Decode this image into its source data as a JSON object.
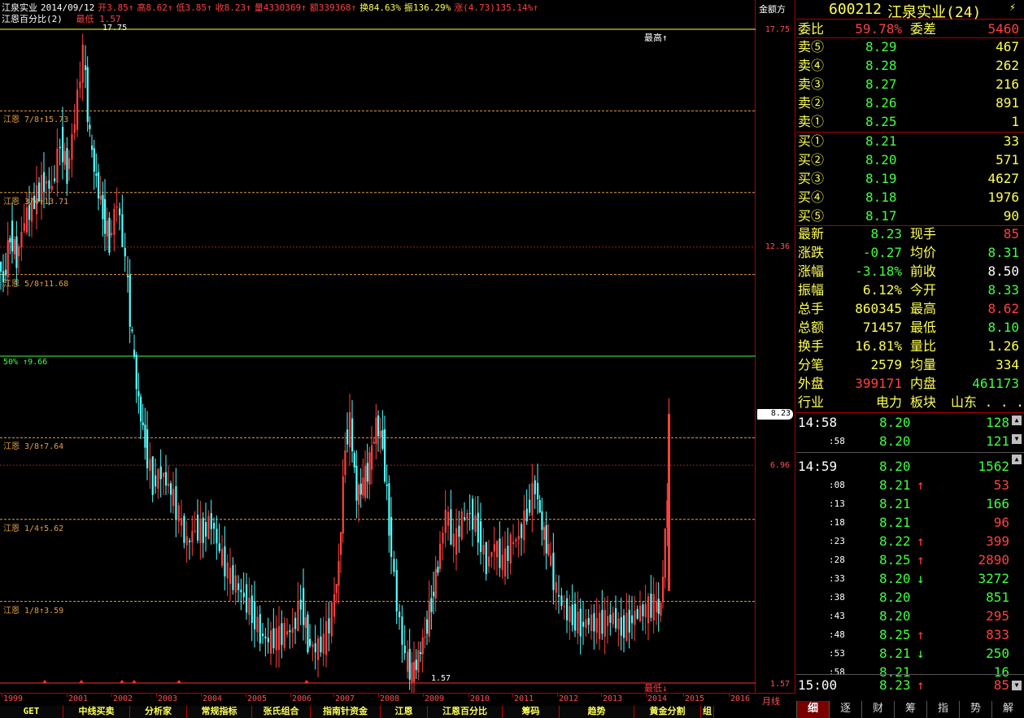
{
  "header": {
    "stock_name": "江泉实业",
    "date": "2014/09/12",
    "open": "开3.85↑",
    "high": "高8.62↑",
    "low": "低3.85↑",
    "close": "收8.23↑",
    "volume": "量4330369↑",
    "amount": "额339368↑",
    "turnover": "换84.63%",
    "amplitude": "振136.29%",
    "change": "涨(4.73)135.14%↑",
    "indicator_name": "江恩百分比(2)",
    "indicator_low": "最低 1.57"
  },
  "chart": {
    "mode_label": "金额方",
    "axis_labels": [
      "17.75",
      "12.36",
      "6.96",
      "1.57"
    ],
    "current_price": "8.23",
    "top_level_label": "17.75",
    "bottom_level_label": "1.57",
    "max_marker": "最高↑",
    "min_marker": "最低↓",
    "gann_levels": [
      {
        "label": "江恩 7/8↑15.73",
        "price": 15.73,
        "color": "#e0a040"
      },
      {
        "label": "江恩 3/4↑13.71",
        "price": 13.71,
        "color": "#e0a040"
      },
      {
        "label": "江恩 5/8↑11.68",
        "price": 11.68,
        "color": "#e0a040"
      },
      {
        "label": "50% ↑9.66",
        "price": 9.66,
        "color": "#40ff40"
      },
      {
        "label": "江恩 3/8↑7.64",
        "price": 7.64,
        "color": "#e0a040"
      },
      {
        "label": "江恩 1/4↑5.62",
        "price": 5.62,
        "color": "#e0a040"
      },
      {
        "label": "江恩 1/8↑3.59",
        "price": 3.59,
        "color": "#e0a040"
      }
    ],
    "price_max": 17.75,
    "price_min": 1.57,
    "x_labels": [
      "1999",
      "2001",
      "2002",
      "2003",
      "2004",
      "2005",
      "2006",
      "2007",
      "2008",
      "2009",
      "2010",
      "2011",
      "2012",
      "2013",
      "2014",
      "2015",
      "2016"
    ],
    "period_label": "月线"
  },
  "bottom_tabs": [
    "GET",
    "中线买卖",
    "分析家",
    "常规指标",
    "张氏组合",
    "指南针资金",
    "江恩",
    "江恩百分比",
    "筹码",
    "趋势",
    "黄金分割",
    "组"
  ],
  "quote": {
    "code": "600212",
    "name": "江泉实业(24)",
    "wei_bi_label": "委比",
    "wei_bi_value": "59.78%",
    "wei_cha_label": "委差",
    "wei_cha_value": "5460",
    "sell": [
      {
        "label": "卖⑤",
        "price": "8.29",
        "vol": "467"
      },
      {
        "label": "卖④",
        "price": "8.28",
        "vol": "262"
      },
      {
        "label": "卖③",
        "price": "8.27",
        "vol": "216"
      },
      {
        "label": "卖②",
        "price": "8.26",
        "vol": "891"
      },
      {
        "label": "卖①",
        "price": "8.25",
        "vol": "1"
      }
    ],
    "buy": [
      {
        "label": "买①",
        "price": "8.21",
        "vol": "33"
      },
      {
        "label": "买②",
        "price": "8.20",
        "vol": "571"
      },
      {
        "label": "买③",
        "price": "8.19",
        "vol": "4627"
      },
      {
        "label": "买④",
        "price": "8.18",
        "vol": "1976"
      },
      {
        "label": "买⑤",
        "price": "8.17",
        "vol": "90"
      }
    ],
    "stats": [
      {
        "l1": "最新",
        "v1": "8.23",
        "c1": "g",
        "l2": "现手",
        "v2": "85",
        "c2": "r"
      },
      {
        "l1": "涨跌",
        "v1": "-0.27",
        "c1": "g",
        "l2": "均价",
        "v2": "8.31",
        "c2": "g"
      },
      {
        "l1": "涨幅",
        "v1": "-3.18%",
        "c1": "g",
        "l2": "前收",
        "v2": "8.50",
        "c2": "w"
      },
      {
        "l1": "振幅",
        "v1": "6.12%",
        "c1": "y",
        "l2": "今开",
        "v2": "8.33",
        "c2": "g"
      },
      {
        "l1": "总手",
        "v1": "860345",
        "c1": "y",
        "l2": "最高",
        "v2": "8.62",
        "c2": "r"
      },
      {
        "l1": "总额",
        "v1": "71457",
        "c1": "y",
        "l2": "最低",
        "v2": "8.10",
        "c2": "g"
      },
      {
        "l1": "换手",
        "v1": "16.81%",
        "c1": "y",
        "l2": "量比",
        "v2": "1.26",
        "c2": "y"
      },
      {
        "l1": "分笔",
        "v1": "2579",
        "c1": "y",
        "l2": "均量",
        "v2": "334",
        "c2": "y"
      },
      {
        "l1": "外盘",
        "v1": "399171",
        "c1": "r",
        "l2": "内盘",
        "v2": "461173",
        "c2": "g"
      }
    ],
    "industry_label": "行业",
    "industry_value": "电力",
    "sector_label": "板块",
    "sector_value": "山东 . . .",
    "ticks": [
      {
        "time": "14:58",
        "price": "8.20",
        "arrow": "",
        "vol": "128",
        "vc": "g"
      },
      {
        "time": ":58",
        "price": "8.20",
        "arrow": "",
        "vol": "121",
        "vc": "g"
      },
      {
        "time": "14:59",
        "price": "8.20",
        "arrow": "",
        "vol": "1562",
        "vc": "g"
      },
      {
        "time": ":08",
        "price": "8.21",
        "arrow": "↑",
        "vol": "53",
        "vc": "r"
      },
      {
        "time": ":13",
        "price": "8.21",
        "arrow": "",
        "vol": "166",
        "vc": "g"
      },
      {
        "time": ":18",
        "price": "8.21",
        "arrow": "",
        "vol": "96",
        "vc": "r"
      },
      {
        "time": ":23",
        "price": "8.22",
        "arrow": "↑",
        "vol": "399",
        "vc": "r"
      },
      {
        "time": ":28",
        "price": "8.25",
        "arrow": "↑",
        "vol": "2890",
        "vc": "r"
      },
      {
        "time": ":33",
        "price": "8.20",
        "arrow": "↓",
        "vol": "3272",
        "vc": "g"
      },
      {
        "time": ":38",
        "price": "8.20",
        "arrow": "",
        "vol": "851",
        "vc": "g"
      },
      {
        "time": ":43",
        "price": "8.20",
        "arrow": "",
        "vol": "295",
        "vc": "r"
      },
      {
        "time": ":48",
        "price": "8.25",
        "arrow": "↑",
        "vol": "833",
        "vc": "r"
      },
      {
        "time": ":53",
        "price": "8.21",
        "arrow": "↓",
        "vol": "250",
        "vc": "g"
      },
      {
        "time": ":58",
        "price": "8.21",
        "arrow": "",
        "vol": "16",
        "vc": "g"
      },
      {
        "time": "15:00",
        "price": "8.23",
        "arrow": "↑",
        "vol": "85",
        "vc": "r"
      }
    ]
  },
  "side_tabs": [
    "细",
    "逐",
    "财",
    "筹",
    "指",
    "势",
    "解"
  ],
  "colors": {
    "up": "#ff4040",
    "down": "#55ffff",
    "frame": "#b00000",
    "label": "#ffff55"
  }
}
